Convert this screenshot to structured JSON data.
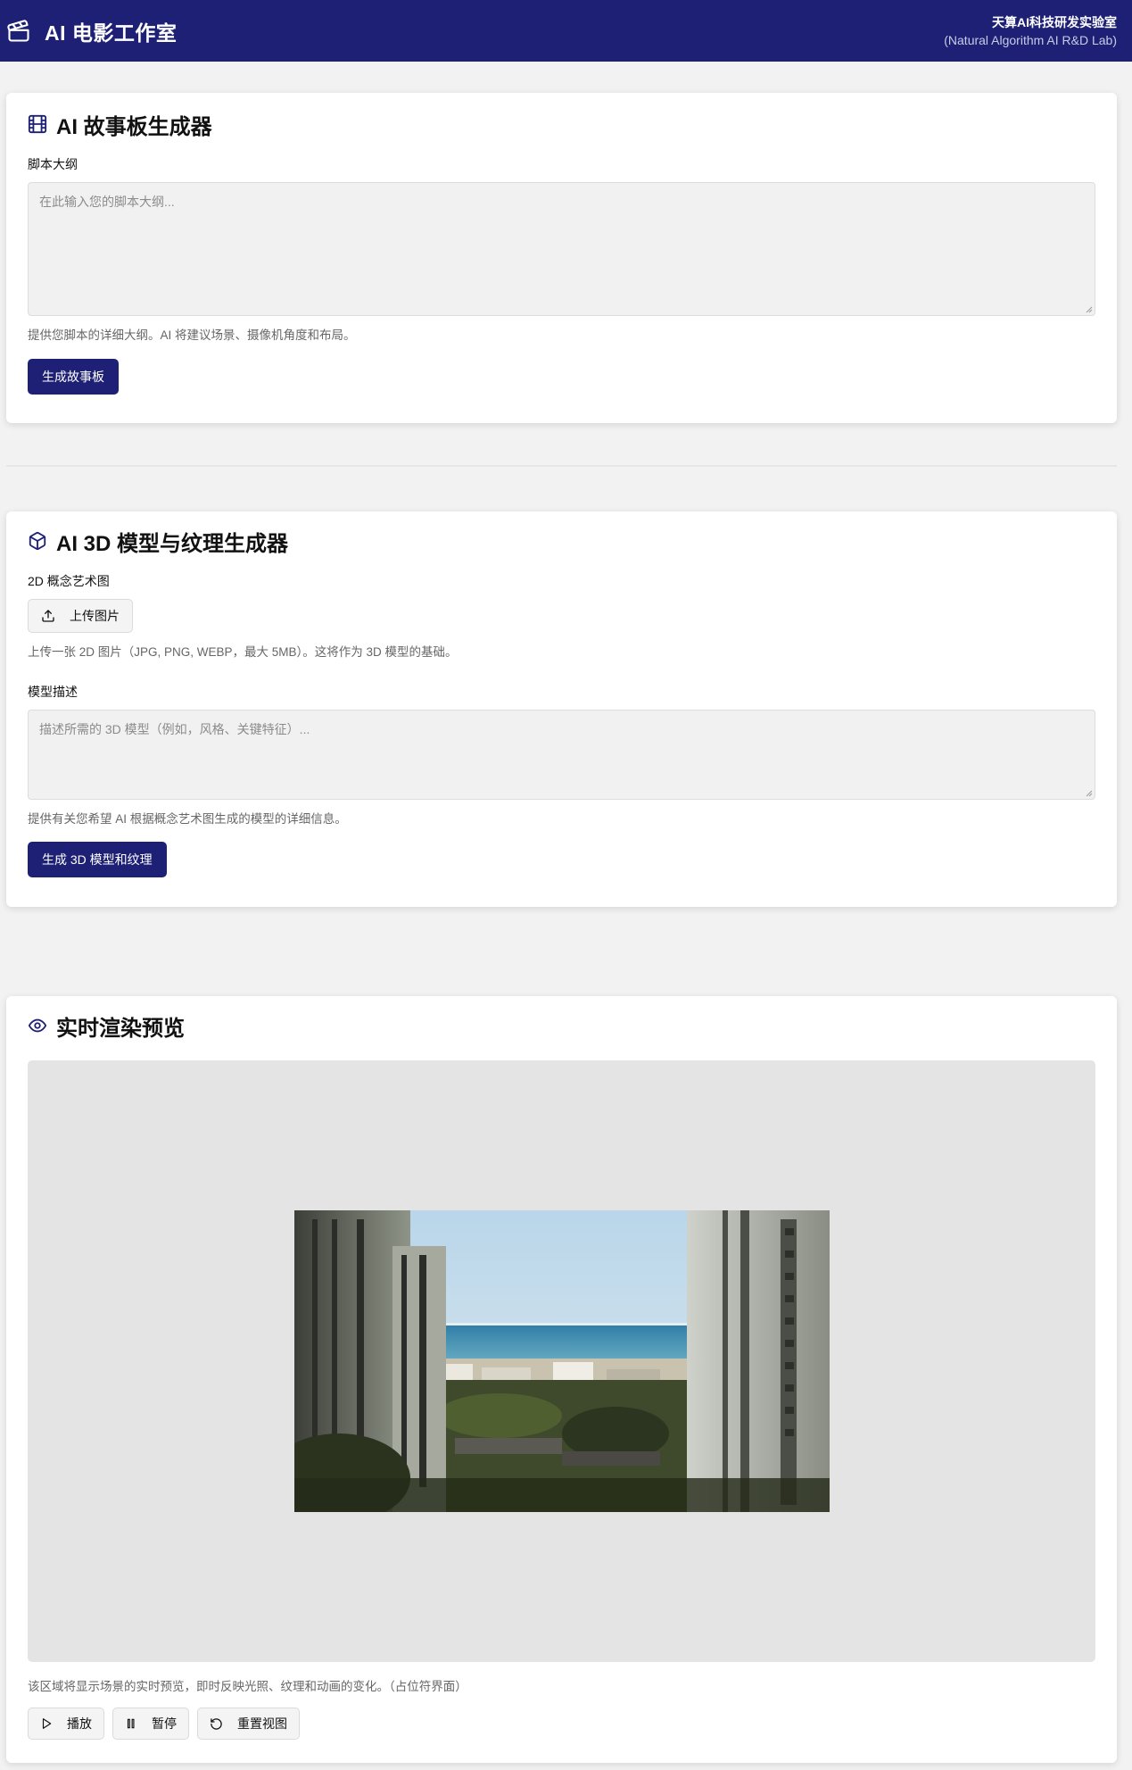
{
  "header": {
    "title": "AI 电影工作室",
    "lab_name": "天算AI科技研发实验室",
    "lab_name_en": "(Natural Algorithm AI R&D Lab)",
    "logo_icon": "clapperboard-icon",
    "background": "#1e2075"
  },
  "storyboard": {
    "title": "AI 故事板生成器",
    "icon": "film-icon",
    "script_label": "脚本大纲",
    "script_placeholder": "在此输入您的脚本大纲...",
    "script_value": "",
    "help": "提供您脚本的详细大纲。AI 将建议场景、摄像机角度和布局。",
    "generate_button": "生成故事板"
  },
  "model3d": {
    "title": "AI 3D 模型与纹理生成器",
    "icon": "cube-icon",
    "concept_label": "2D 概念艺术图",
    "upload_button": "上传图片",
    "upload_icon": "upload-icon",
    "upload_help": "上传一张 2D 图片（JPG, PNG, WEBP，最大 5MB）。这将作为 3D 模型的基础。",
    "desc_label": "模型描述",
    "desc_placeholder": "描述所需的 3D 模型（例如，风格、关键特征）...",
    "desc_value": "",
    "desc_help": "提供有关您希望 AI 根据概念艺术图生成的模型的详细信息。",
    "generate_button": "生成 3D 模型和纹理"
  },
  "preview": {
    "title": "实时渲染预览",
    "icon": "eye-icon",
    "help": "该区域将显示场景的实时预览，即时反映光照、纹理和动画的变化。（占位符界面）",
    "play_button": "播放",
    "pause_button": "暂停",
    "reset_button": "重置视图",
    "play_icon": "play-icon",
    "pause_icon": "pause-icon",
    "reset_icon": "rotate-ccw-icon"
  },
  "colors": {
    "accent": "#1e2075",
    "page_bg": "#f2f2f3",
    "card_bg": "#ffffff",
    "preview_bg": "#e4e4e4"
  }
}
